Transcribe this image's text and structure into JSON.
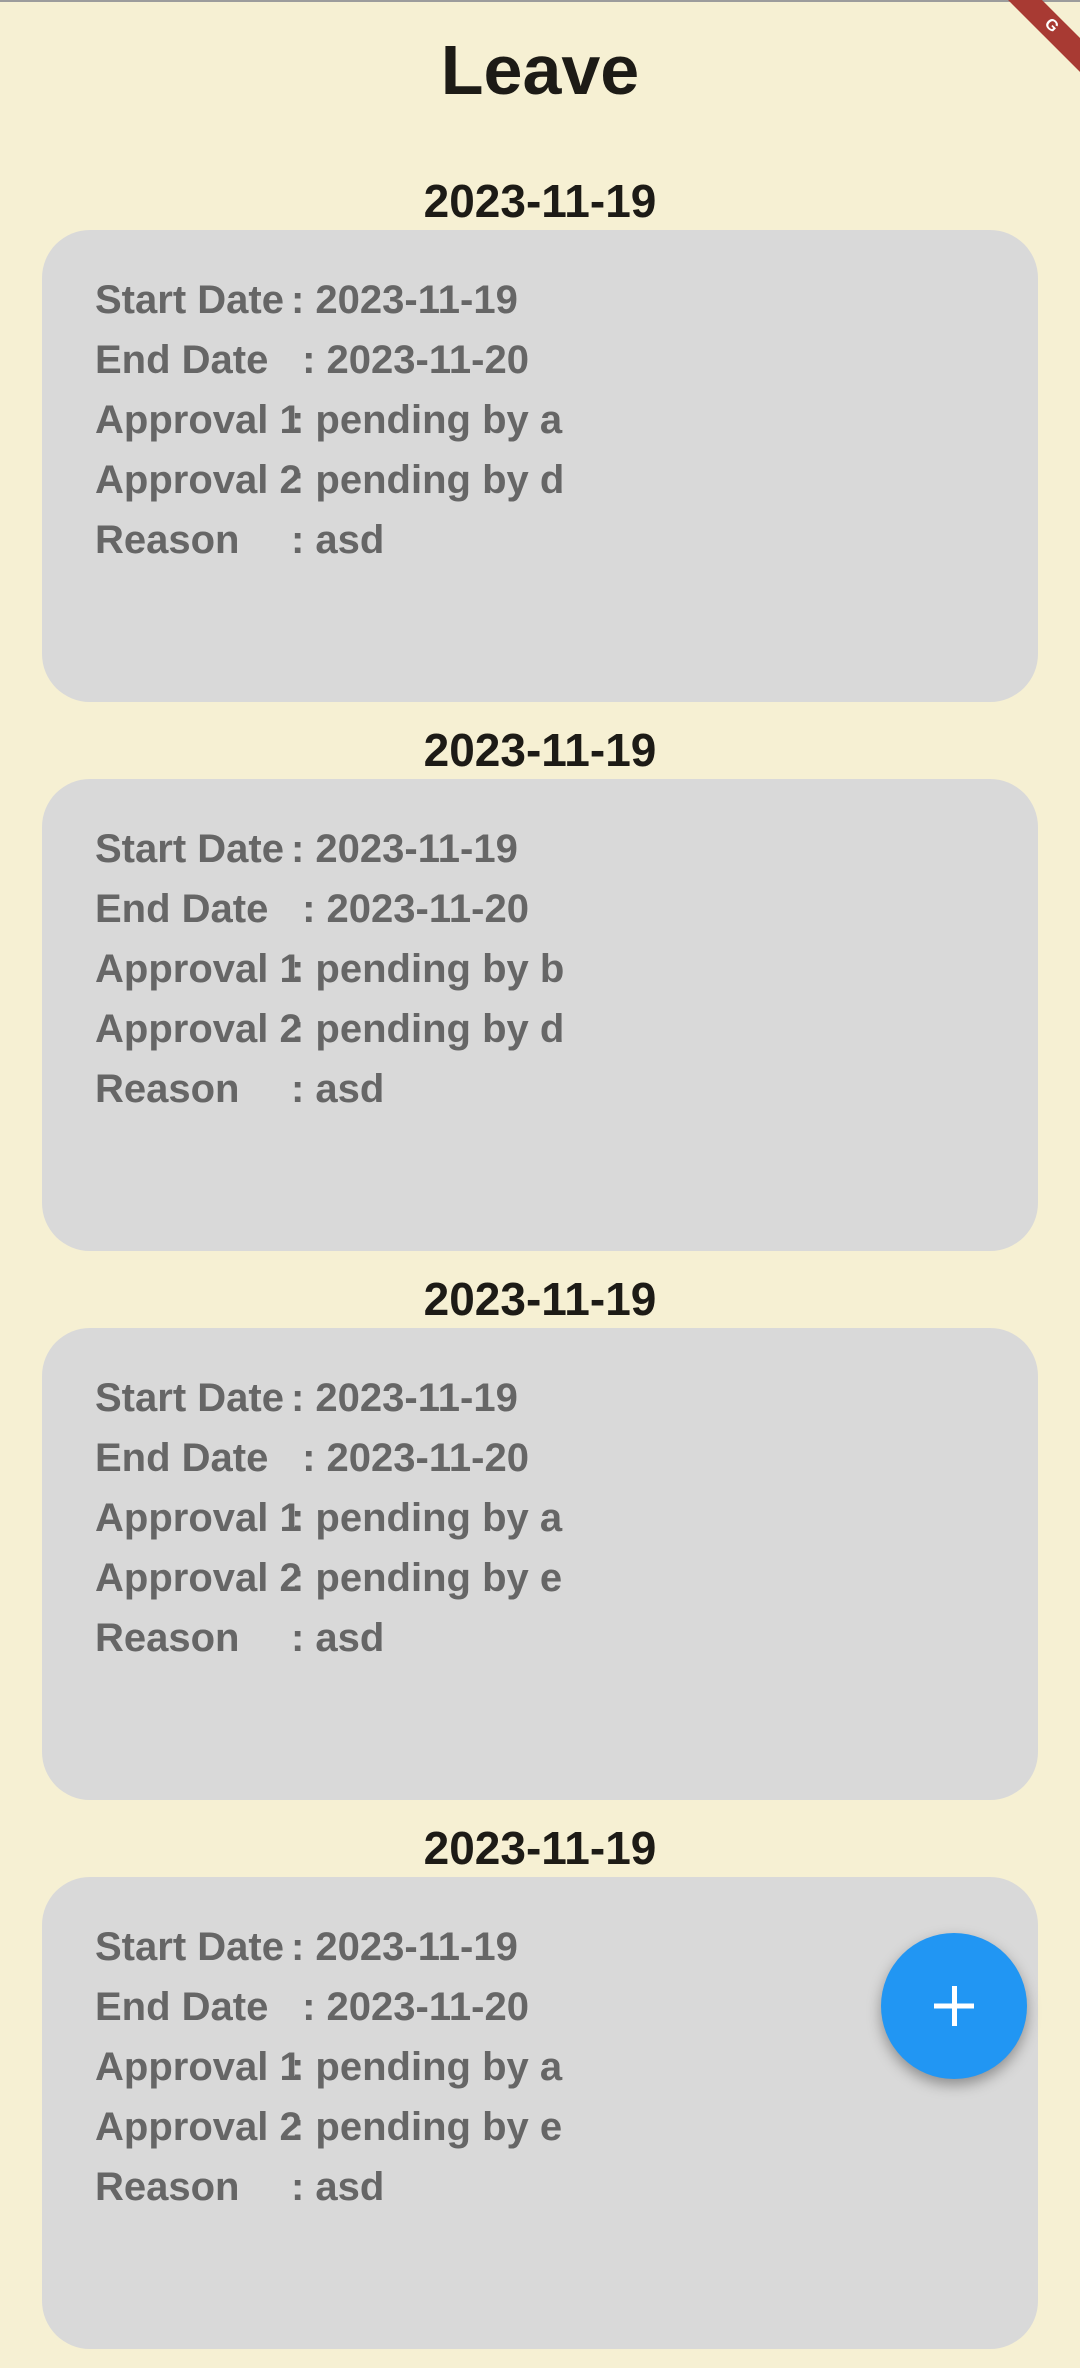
{
  "header": {
    "title": "Leave"
  },
  "debug_banner": {
    "label": "G"
  },
  "leaves": [
    {
      "date": "2023-11-19",
      "rows": [
        {
          "label": "Start Date",
          "value": ": 2023-11-19"
        },
        {
          "label": "End Date",
          "value": " : 2023-11-20"
        },
        {
          "label": "Approval 1",
          "value": ": pending by a"
        },
        {
          "label": "Approval 2",
          "value": ": pending by d"
        },
        {
          "label": "Reason",
          "value": ": asd"
        }
      ]
    },
    {
      "date": "2023-11-19",
      "rows": [
        {
          "label": "Start Date",
          "value": ": 2023-11-19"
        },
        {
          "label": "End Date",
          "value": " : 2023-11-20"
        },
        {
          "label": "Approval 1",
          "value": ": pending by b"
        },
        {
          "label": "Approval 2",
          "value": ": pending by d"
        },
        {
          "label": "Reason",
          "value": ": asd"
        }
      ]
    },
    {
      "date": "2023-11-19",
      "rows": [
        {
          "label": "Start Date",
          "value": ": 2023-11-19"
        },
        {
          "label": "End Date",
          "value": " : 2023-11-20"
        },
        {
          "label": "Approval 1",
          "value": ": pending by a"
        },
        {
          "label": "Approval 2",
          "value": ": pending by e"
        },
        {
          "label": "Reason",
          "value": ": asd"
        }
      ]
    },
    {
      "date": "2023-11-19",
      "rows": [
        {
          "label": "Start Date",
          "value": ": 2023-11-19"
        },
        {
          "label": "End Date",
          "value": " : 2023-11-20"
        },
        {
          "label": "Approval 1",
          "value": ": pending by a"
        },
        {
          "label": "Approval 2",
          "value": ": pending by e"
        },
        {
          "label": "Reason",
          "value": ": asd"
        }
      ]
    }
  ],
  "fab": {
    "icon": "plus-icon",
    "color": "#2196f3"
  },
  "colors": {
    "background": "#f6f0d3",
    "card": "#d9d9d9",
    "text_dark": "#1d1b16",
    "text_muted": "#666666",
    "debug_banner": "#a83a33"
  }
}
